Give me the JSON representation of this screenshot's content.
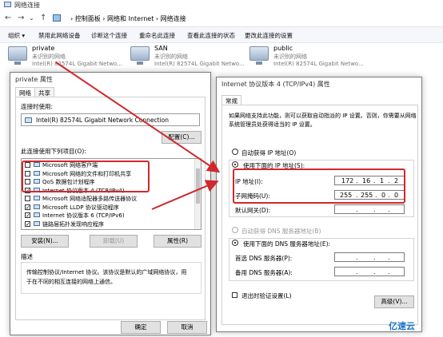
{
  "explorer": {
    "title": "网络连接",
    "breadcrumb": [
      "控制面板",
      "网络和 Internet",
      "网络连接"
    ],
    "toolbar": [
      "组织 ▾",
      "禁用此网络设备",
      "诊断这个连接",
      "重命名此连接",
      "查看此连接的状态",
      "更改此连接的设置"
    ],
    "adapters": [
      {
        "name": "private",
        "status": "未识别的网络",
        "device": "Intel(R) 82574L Gigabit Netwo..."
      },
      {
        "name": "SAN",
        "status": "未识别的网络",
        "device": "Intel(R) 82574L Gigabit Netwo..."
      },
      {
        "name": "public",
        "status": "未识别的网络",
        "device": "Intel(R) 82574L Gigabit Netwo..."
      }
    ]
  },
  "props": {
    "title": "private 属性",
    "tabs": [
      "网络",
      "共享"
    ],
    "connect_using_label": "连接时使用:",
    "adapter_name": "Intel(R) 82574L Gigabit Network Connection",
    "configure": "配置(C)...",
    "items_label": "此连接使用下列项目(O):",
    "items": [
      {
        "label": "Microsoft 网络客户端",
        "checked": false
      },
      {
        "label": "Microsoft 网络的文件和打印机共享",
        "checked": false
      },
      {
        "label": "QoS 数据包计划程序",
        "checked": false
      },
      {
        "label": "Internet 协议版本 4 (TCP/IPv4)",
        "checked": true
      },
      {
        "label": "Microsoft 网络适配器多路传送器协议",
        "checked": false
      },
      {
        "label": "Microsoft LLDP 协议驱动程序",
        "checked": true
      },
      {
        "label": "Internet 协议版本 6 (TCP/IPv6)",
        "checked": true
      },
      {
        "label": "链路层拓扑发现响应程序",
        "checked": true
      }
    ],
    "install": "安装(N)...",
    "uninstall": "卸载(U)",
    "properties": "属性(R)",
    "desc_title": "描述",
    "desc_text_1": "传输控制协议/Internet 协议。该协议是默认的广域网络协议，用",
    "desc_text_2": "于在不同的相互连接的网络上通信。",
    "ok": "确定",
    "cancel": "取消"
  },
  "ipv4": {
    "title": "Internet 协议版本 4 (TCP/IPv4) 属性",
    "tab": "常规",
    "intro_1": "如果网络支持此功能，则可以获取自动指派的 IP 设置。否则，你需要从网络",
    "intro_2": "系统管理员处获得适当的 IP 设置。",
    "auto_ip": "自动获得 IP 地址(O)",
    "manual_ip": "使用下面的 IP 地址(S):",
    "ip_label": "IP 地址(I):",
    "ip_value": [
      "172",
      "16",
      "1",
      "2"
    ],
    "mask_label": "子网掩码(U):",
    "mask_value": [
      "255",
      "255",
      "0",
      "0"
    ],
    "gw_label": "默认网关(D):",
    "auto_dns": "自动获得 DNS 服务器地址(B)",
    "manual_dns": "使用下面的 DNS 服务器地址(E):",
    "dns1_label": "首选 DNS 服务器(P):",
    "dns2_label": "备用 DNS 服务器(A):",
    "validate": "退出时验证设置(L)",
    "advanced": "高级(V)..."
  },
  "watermark": "亿速云"
}
